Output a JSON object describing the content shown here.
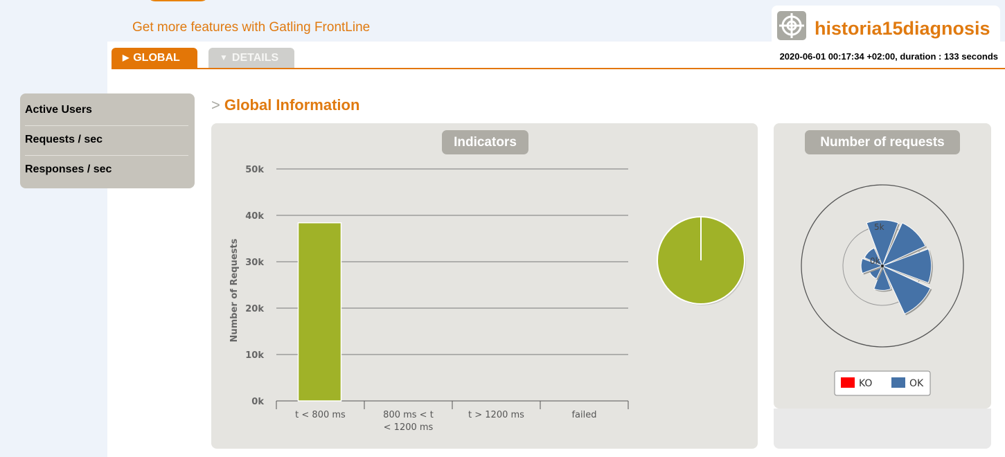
{
  "header": {
    "promo_text": "Get more features with Gatling FrontLine",
    "simulation_name": "historia15diagnosis",
    "run_info": "2020-06-01 00:17:34 +02:00, duration : 133 seconds",
    "colors": {
      "accent": "#e37607",
      "menu_bg": "#c6c3bb",
      "panel_bg": "#e5e4e0"
    }
  },
  "tabs": {
    "global_label": "GLOBAL",
    "details_label": "DETAILS"
  },
  "sidemenu": {
    "items": [
      {
        "label": "Active Users"
      },
      {
        "label": "Requests / sec"
      },
      {
        "label": "Responses / sec"
      }
    ]
  },
  "section": {
    "title": "Global Information"
  },
  "indicators": {
    "title": "Indicators"
  },
  "requests_panel": {
    "title": "Number of requests"
  },
  "chart_data": [
    {
      "type": "bar",
      "title": "Indicators",
      "ylabel": "Number of Requests",
      "ylim": [
        0,
        50000
      ],
      "yticks": [
        "0k",
        "10k",
        "20k",
        "30k",
        "40k",
        "50k"
      ],
      "categories": [
        "t < 800 ms",
        "800 ms < t < 1200 ms",
        "t > 1200 ms",
        "failed"
      ],
      "values": [
        38400,
        0,
        0,
        0
      ],
      "grid": true,
      "color": "#a0b228"
    },
    {
      "type": "pie",
      "slices": [
        {
          "label": "t < 800 ms",
          "value": 100,
          "color": "#a0b228"
        }
      ]
    },
    {
      "type": "polar",
      "title": "Number of requests",
      "rings": [
        "0k",
        "5k"
      ],
      "series": [
        {
          "name": "KO",
          "color": "#ff0000",
          "values": [
            0,
            0,
            0,
            0,
            0,
            0,
            0,
            0
          ]
        },
        {
          "name": "OK",
          "color": "#4572a7",
          "values": [
            5800,
            6000,
            6200,
            6700,
            3100,
            1800,
            2700,
            2500
          ]
        }
      ],
      "legend": "bottom"
    }
  ]
}
